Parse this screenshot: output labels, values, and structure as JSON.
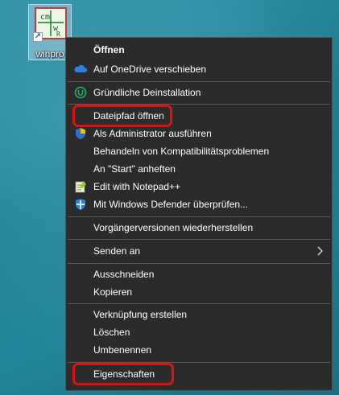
{
  "desktop": {
    "icon_label": "winpro",
    "icon_glyph_letters": [
      "cm",
      "w",
      "R"
    ]
  },
  "menu": {
    "items": [
      {
        "label": "Öffnen",
        "icon": "none",
        "bold": true
      },
      {
        "label": "Auf OneDrive verschieben",
        "icon": "onedrive-cloud-icon"
      },
      {
        "label": "Gründliche Deinstallation",
        "icon": "uninstaller-u-icon"
      },
      {
        "label": "Dateipfad öffnen",
        "icon": "none"
      },
      {
        "label": "Als Administrator ausführen",
        "icon": "uac-shield-icon"
      },
      {
        "label": "Behandeln von Kompatibilitätsproblemen",
        "icon": "none"
      },
      {
        "label": "An \"Start\" anheften",
        "icon": "none"
      },
      {
        "label": "Edit with Notepad++",
        "icon": "notepadpp-icon"
      },
      {
        "label": "Mit Windows Defender überprüfen...",
        "icon": "defender-icon"
      },
      {
        "label": "Vorgängerversionen wiederherstellen",
        "icon": "none"
      },
      {
        "label": "Senden an",
        "icon": "none",
        "submenu": true
      },
      {
        "label": "Ausschneiden",
        "icon": "none"
      },
      {
        "label": "Kopieren",
        "icon": "none"
      },
      {
        "label": "Verknüpfung erstellen",
        "icon": "none"
      },
      {
        "label": "Löschen",
        "icon": "none"
      },
      {
        "label": "Umbenennen",
        "icon": "none"
      },
      {
        "label": "Eigenschaften",
        "icon": "none"
      }
    ],
    "highlighted": [
      "Dateipfad öffnen",
      "Eigenschaften"
    ]
  },
  "colors": {
    "menu_bg": "#2b2b2b",
    "highlight": "#e01010",
    "onedrive": "#2d7fe0",
    "uninstaller": "#19b36b"
  }
}
